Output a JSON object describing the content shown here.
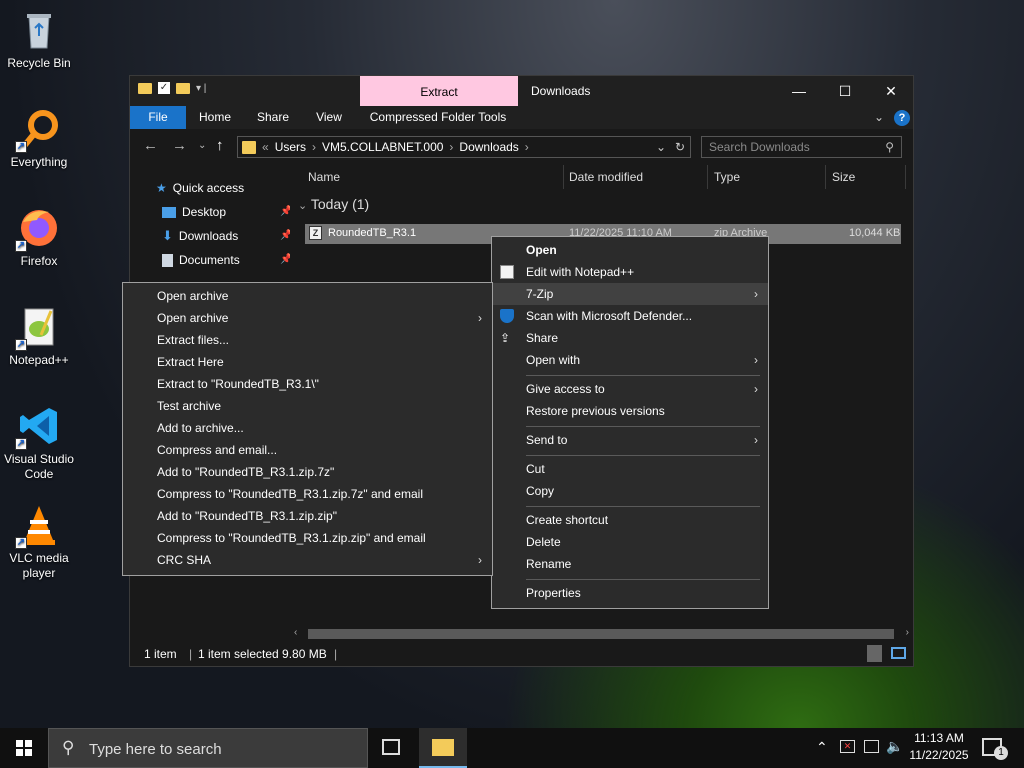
{
  "desktop": {
    "icons": [
      {
        "label": "Recycle Bin",
        "icon": "recycle-bin-icon"
      },
      {
        "label": "Everything",
        "icon": "everything-search-icon"
      },
      {
        "label": "Firefox",
        "icon": "firefox-icon"
      },
      {
        "label": "Notepad++",
        "icon": "notepad-plus-plus-icon"
      },
      {
        "label": "Visual Studio Code",
        "icon": "vscode-icon"
      },
      {
        "label": "VLC media player",
        "icon": "vlc-icon"
      }
    ]
  },
  "window": {
    "title": "Downloads",
    "context_tab": "Extract",
    "ribbon_tabs": [
      "File",
      "Home",
      "Share",
      "View",
      "Compressed Folder Tools"
    ],
    "address": {
      "overflow": "«",
      "crumbs": [
        "Users",
        "VM5.COLLABNET.000",
        "Downloads"
      ]
    },
    "search_placeholder": "Search Downloads",
    "nav": [
      {
        "label": "Quick access",
        "icon": "star-icon"
      },
      {
        "label": "Desktop",
        "icon": "desktop-folder-icon"
      },
      {
        "label": "Downloads",
        "icon": "download-arrow-icon"
      },
      {
        "label": "Documents",
        "icon": "document-icon"
      }
    ],
    "columns": [
      "Name",
      "Date modified",
      "Type",
      "Size"
    ],
    "group_label": "Today (1)",
    "file": {
      "name": "RoundedTB_R3.1",
      "date": "11/22/2025 11:10 AM",
      "type": "zip Archive",
      "size": "10,044 KB"
    },
    "status": {
      "count": "1 item",
      "selected": "1 item selected  9.80 MB"
    }
  },
  "context_menu": {
    "items": [
      {
        "label": "Open",
        "bold": true
      },
      {
        "label": "Edit with Notepad++",
        "icon": "notepad-plus-plus-icon"
      },
      {
        "label": "7-Zip",
        "submenu": true,
        "highlighted": true
      },
      {
        "label": "Scan with Microsoft Defender...",
        "icon": "defender-shield-icon"
      },
      {
        "label": "Share",
        "icon": "share-icon"
      },
      {
        "label": "Open with",
        "submenu": true
      },
      {
        "label": "Give access to",
        "submenu": true
      },
      {
        "label": "Restore previous versions"
      },
      {
        "label": "Send to",
        "submenu": true
      },
      {
        "label": "Cut"
      },
      {
        "label": "Copy"
      },
      {
        "label": "Create shortcut"
      },
      {
        "label": "Delete"
      },
      {
        "label": "Rename"
      },
      {
        "label": "Properties"
      }
    ]
  },
  "submenu_7zip": {
    "items": [
      {
        "label": "Open archive"
      },
      {
        "label": "Open archive",
        "submenu": true
      },
      {
        "label": "Extract files..."
      },
      {
        "label": "Extract Here"
      },
      {
        "label": "Extract to \"RoundedTB_R3.1\\\""
      },
      {
        "label": "Test archive"
      },
      {
        "label": "Add to archive..."
      },
      {
        "label": "Compress and email..."
      },
      {
        "label": "Add to \"RoundedTB_R3.1.zip.7z\""
      },
      {
        "label": "Compress to \"RoundedTB_R3.1.zip.7z\" and email"
      },
      {
        "label": "Add to \"RoundedTB_R3.1.zip.zip\""
      },
      {
        "label": "Compress to \"RoundedTB_R3.1.zip.zip\" and email"
      },
      {
        "label": "CRC SHA",
        "submenu": true
      }
    ]
  },
  "taskbar": {
    "search_placeholder": "Type here to search",
    "time": "11:13 AM",
    "date": "11/22/2025",
    "notification_count": "1"
  }
}
